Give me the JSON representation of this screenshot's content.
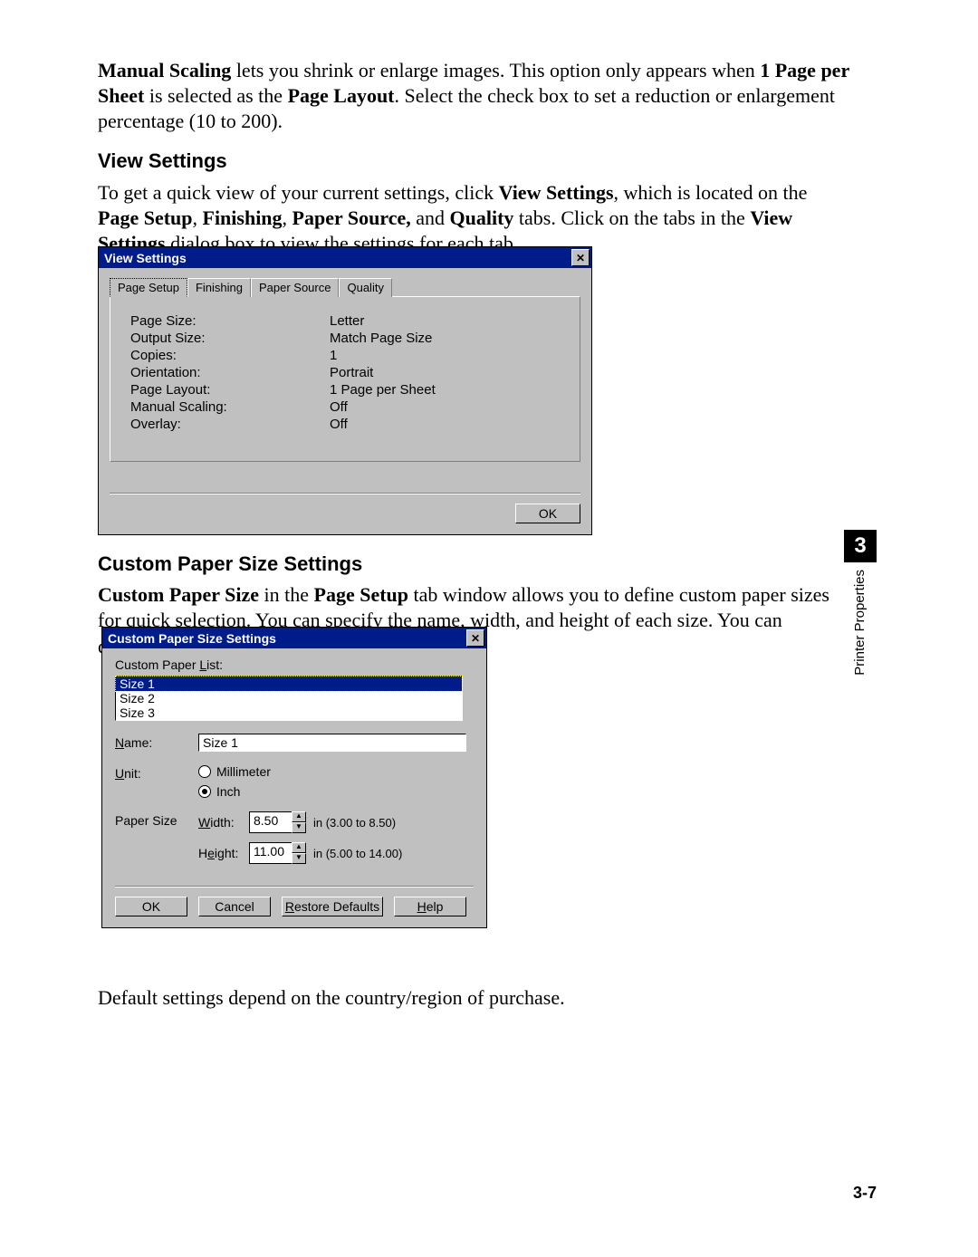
{
  "sidebar": {
    "chapter_number": "3",
    "chapter_label": "Printer Properties"
  },
  "page_number": "3-7",
  "content": {
    "p1_pre": "Manual Scaling",
    "p1_mid1": " lets you shrink or enlarge images. This option only appears when ",
    "p1_b2": "1 Page per Sheet",
    "p1_mid2": " is selected as the ",
    "p1_b3": "Page Layout",
    "p1_mid3": ". Select the check box to set a reduction or enlargement percentage (10 to 200).",
    "h_view": "View Settings",
    "view_pre": "To get a quick view of your current settings, click ",
    "view_b1": "View Settings",
    "view_mid1": ", which is located on the ",
    "view_b2": "Page Setup",
    "view_sep1": ", ",
    "view_b3": "Finishing",
    "view_sep2": ", ",
    "view_b4": "Paper Source,",
    "view_mid2": " and ",
    "view_b5": "Quality",
    "view_mid3": " tabs. Click on the tabs in the ",
    "view_b6": "View Settings",
    "view_mid4": " dialog box to view the settings for each tab.",
    "h_custom": "Custom Paper Size Settings",
    "custom_b1": "Custom Paper Size",
    "custom_mid1": " in the ",
    "custom_b2": "Page Setup",
    "custom_mid2": " tab window allows you to define custom paper sizes for quick selection. You can specify the name, width, and height of each size. You can designate up to three custom sizes.",
    "footer": "Default settings depend on the country/region of purchase."
  },
  "view_dialog": {
    "title": "View Settings",
    "tabs": [
      "Page Setup",
      "Finishing",
      "Paper Source",
      "Quality"
    ],
    "active_tab": 0,
    "rows": [
      {
        "label": "Page Size:",
        "value": "Letter"
      },
      {
        "label": "Output Size:",
        "value": "Match Page Size"
      },
      {
        "label": "Copies:",
        "value": "1"
      },
      {
        "label": "Orientation:",
        "value": "Portrait"
      },
      {
        "label": "Page Layout:",
        "value": "1 Page per Sheet"
      },
      {
        "label": "Manual Scaling:",
        "value": "Off"
      },
      {
        "label": "Overlay:",
        "value": "Off"
      }
    ],
    "ok": "OK"
  },
  "custom_dialog": {
    "title": "Custom Paper Size Settings",
    "list_label_pre": "Custom Paper ",
    "list_label_ul": "L",
    "list_label_post": "ist:",
    "items": [
      "Size 1",
      "Size 2",
      "Size 3"
    ],
    "selected": 0,
    "name_lbl_ul": "N",
    "name_lbl_post": "ame:",
    "name_value": "Size 1",
    "unit_lbl_ul": "U",
    "unit_lbl_post": "nit:",
    "unit_mm": "Millimeter",
    "unit_in": "Inch",
    "unit_selected": "inch",
    "papersize_lbl": "Paper Size",
    "width_ul": "W",
    "width_post": "idth:",
    "width_val": "8.50",
    "width_range": "in (3.00 to 8.50)",
    "height_pre": "H",
    "height_ul": "e",
    "height_post": "ight:",
    "height_val": "11.00",
    "height_range": "in (5.00 to 14.00)",
    "ok": "OK",
    "cancel": "Cancel",
    "restore_ul": "R",
    "restore_post": "estore Defaults",
    "help_ul": "H",
    "help_post": "elp"
  }
}
